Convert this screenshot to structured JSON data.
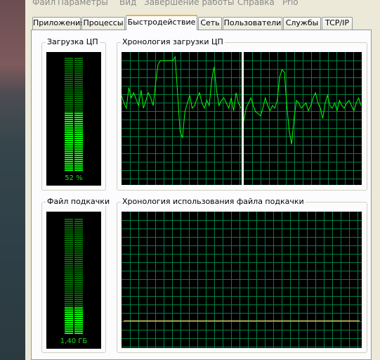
{
  "menu": [
    {
      "label": "Файл"
    },
    {
      "label": "Параметры"
    },
    {
      "label": "Вид"
    },
    {
      "label": "Завершение работы"
    },
    {
      "label": "Справка"
    },
    {
      "label": "Prio"
    }
  ],
  "tabs": [
    {
      "label": "Приложения"
    },
    {
      "label": "Процессы"
    },
    {
      "label": "Быстродействие",
      "active": true
    },
    {
      "label": "Сеть"
    },
    {
      "label": "Пользователи"
    },
    {
      "label": "Службы"
    },
    {
      "label": "TCP/IP"
    }
  ],
  "cpu_usage": {
    "title": "Загрузка ЦП",
    "value_text": "52 %",
    "fraction": 0.52
  },
  "cpu_history": {
    "title": "Хронология загрузки ЦП",
    "core1": [
      68,
      62,
      58,
      74,
      66,
      70,
      65,
      60,
      72,
      58,
      64,
      70,
      66,
      60,
      78,
      92,
      95,
      95,
      95,
      95,
      95,
      95,
      98,
      70,
      40,
      35,
      55,
      62,
      68,
      58,
      60,
      66,
      70,
      62,
      58,
      64,
      60,
      80,
      90,
      72,
      60,
      64,
      66,
      62,
      58,
      66,
      56,
      70,
      62,
      58
    ],
    "core2": [
      48,
      58,
      62,
      66,
      60,
      55,
      54,
      52,
      58,
      66,
      60,
      56,
      60,
      58,
      64,
      82,
      88,
      86,
      60,
      40,
      30,
      50,
      64,
      62,
      58,
      60,
      62,
      56,
      60,
      66,
      70,
      62,
      58,
      50,
      62,
      68,
      60,
      58,
      62,
      56,
      64,
      60,
      58,
      62,
      64,
      60,
      56,
      62,
      66,
      60
    ]
  },
  "pagefile": {
    "title": "Файл подкачки",
    "value_text": "1,40 ГБ",
    "fraction": 0.23
  },
  "pagefile_history": {
    "title": "Хронология использования файла подкачки",
    "level": 0.2
  },
  "colors": {
    "graph_line": "#00ff00",
    "grid": "#008040",
    "meter_on": "#00ff00",
    "meter_off": "#006a00",
    "pagefile_line": "#ffff80"
  }
}
